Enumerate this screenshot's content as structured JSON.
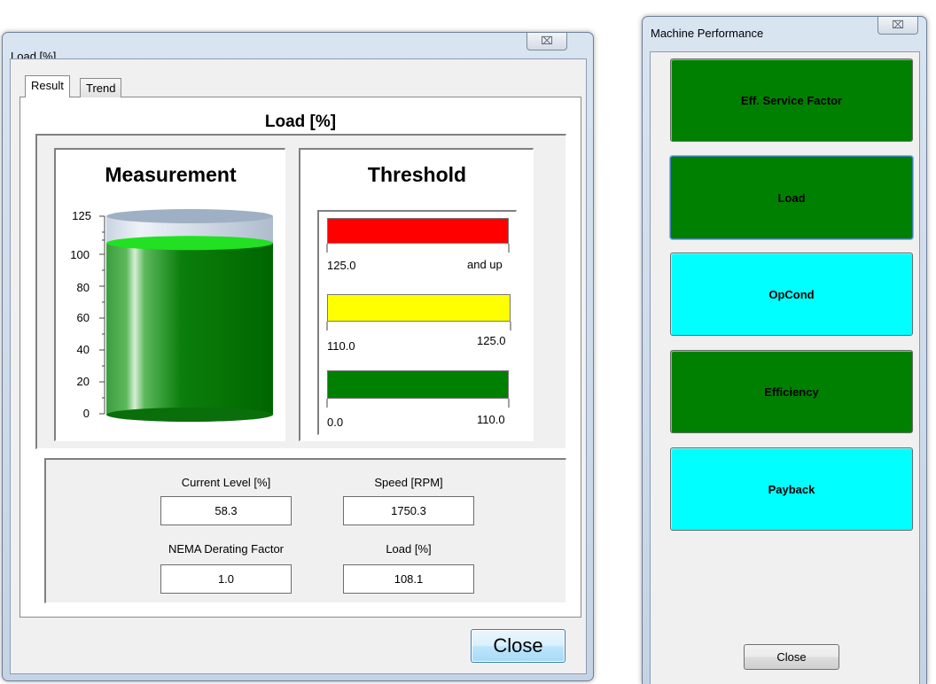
{
  "load_window": {
    "title": "Load [%]",
    "close_x": "⌧",
    "tabs": [
      {
        "label": "Result"
      },
      {
        "label": "Trend"
      }
    ],
    "heading": "Load [%]",
    "measurement": {
      "heading": "Measurement",
      "scale": [
        "125",
        "100",
        "80",
        "60",
        "40",
        "20",
        "0"
      ],
      "max": 125,
      "fill_value": 108.1,
      "fill_color": "#008000"
    },
    "threshold": {
      "heading": "Threshold",
      "bands": [
        {
          "color": "#ff0000",
          "low": "125.0",
          "high": "and up"
        },
        {
          "color": "#ffff00",
          "low": "110.0",
          "high": "125.0"
        },
        {
          "color": "#008000",
          "low": "0.0",
          "high": "110.0"
        }
      ]
    },
    "fields": {
      "current_level": {
        "label": "Current Level [%]",
        "value": "58.3"
      },
      "speed": {
        "label": "Speed [RPM]",
        "value": "1750.3"
      },
      "nema": {
        "label": "NEMA Derating Factor",
        "value": "1.0"
      },
      "load": {
        "label": "Load [%]",
        "value": "108.1"
      }
    },
    "close_label": "Close"
  },
  "machine_performance": {
    "title": "Machine Performance",
    "close_x": "⌧",
    "buttons": [
      {
        "label": "Eff. Service Factor",
        "color": "#008000"
      },
      {
        "label": "Load",
        "color": "#008000"
      },
      {
        "label": "OpCond",
        "color": "#00ffff"
      },
      {
        "label": "Efficiency",
        "color": "#008000"
      },
      {
        "label": "Payback",
        "color": "#00ffff"
      }
    ],
    "close_label": "Close"
  }
}
